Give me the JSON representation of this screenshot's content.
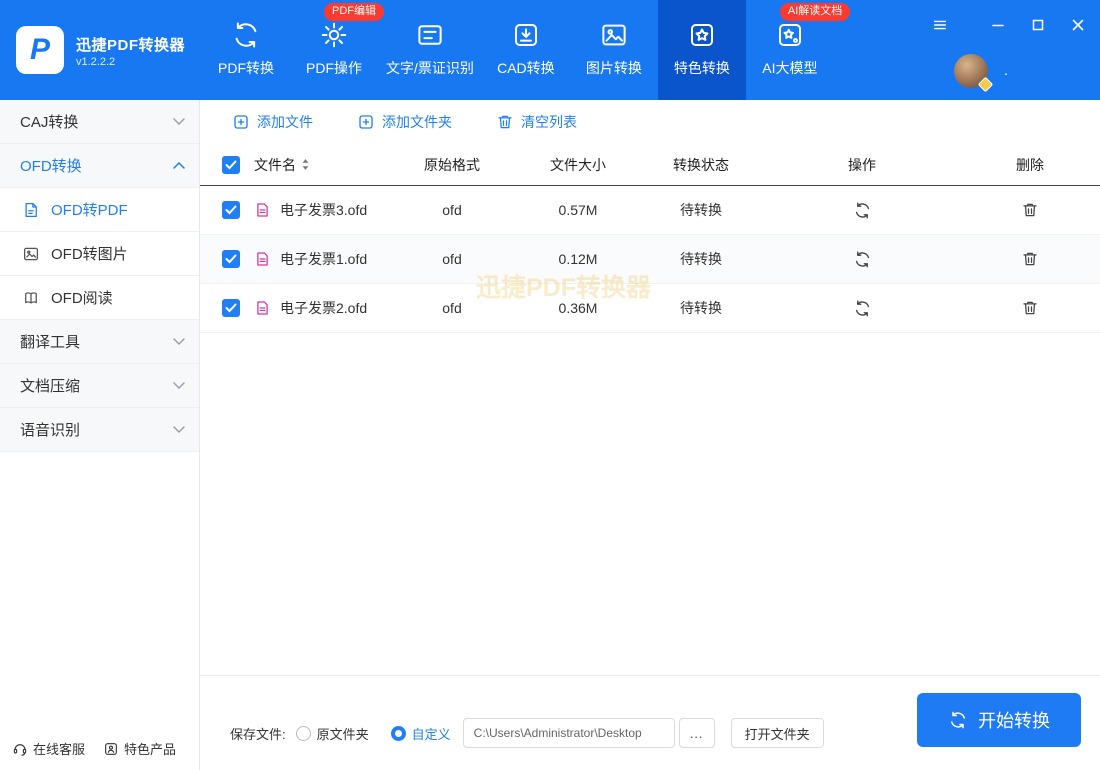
{
  "app": {
    "name": "迅捷PDF转换器",
    "version": "v1.2.2.2",
    "logo_letter": "P",
    "watermark": "迅捷PDF转换器"
  },
  "user": {
    "name": "."
  },
  "colors": {
    "topbar": "#1778f2",
    "nav_active": "#0b55cc",
    "accent": "#2080f3",
    "badge": "#fb3b30",
    "start_button": "#1f7bf4",
    "ofd_icon": "#d6369f"
  },
  "topnav": {
    "items": [
      {
        "label": "PDF转换"
      },
      {
        "label": "PDF操作",
        "badge": "PDF编辑"
      },
      {
        "label": "文字/票证识别"
      },
      {
        "label": "CAD转换"
      },
      {
        "label": "图片转换"
      },
      {
        "label": "特色转换"
      },
      {
        "label": "AI大模型",
        "badge": "AI解读文档"
      }
    ]
  },
  "sidebar": {
    "groups": [
      {
        "label": "CAJ转换"
      },
      {
        "label": "OFD转换"
      },
      {
        "label": "翻译工具"
      },
      {
        "label": "文档压缩"
      },
      {
        "label": "语音识别"
      }
    ],
    "subitems": [
      {
        "label": "OFD转PDF"
      },
      {
        "label": "OFD转图片"
      },
      {
        "label": "OFD阅读"
      }
    ],
    "footer": [
      {
        "label": "在线客服"
      },
      {
        "label": "特色产品"
      }
    ]
  },
  "toolbar": {
    "add_file": "添加文件",
    "add_folder": "添加文件夹",
    "clear_list": "清空列表"
  },
  "table": {
    "headers": {
      "name": "文件名",
      "format": "原始格式",
      "size": "文件大小",
      "status": "转换状态",
      "action": "操作",
      "delete": "删除"
    },
    "rows": [
      {
        "name": "电子发票3.ofd",
        "format": "ofd",
        "size": "0.57M",
        "status": "待转换"
      },
      {
        "name": "电子发票1.ofd",
        "format": "ofd",
        "size": "0.12M",
        "status": "待转换"
      },
      {
        "name": "电子发票2.ofd",
        "format": "ofd",
        "size": "0.36M",
        "status": "待转换"
      }
    ]
  },
  "footer": {
    "save_label": "保存文件:",
    "radio_original": "原文件夹",
    "radio_custom": "自定义",
    "path_value": "C:\\Users\\Administrator\\Desktop",
    "browse_label": "…",
    "open_folder": "打开文件夹",
    "start": "开始转换"
  }
}
